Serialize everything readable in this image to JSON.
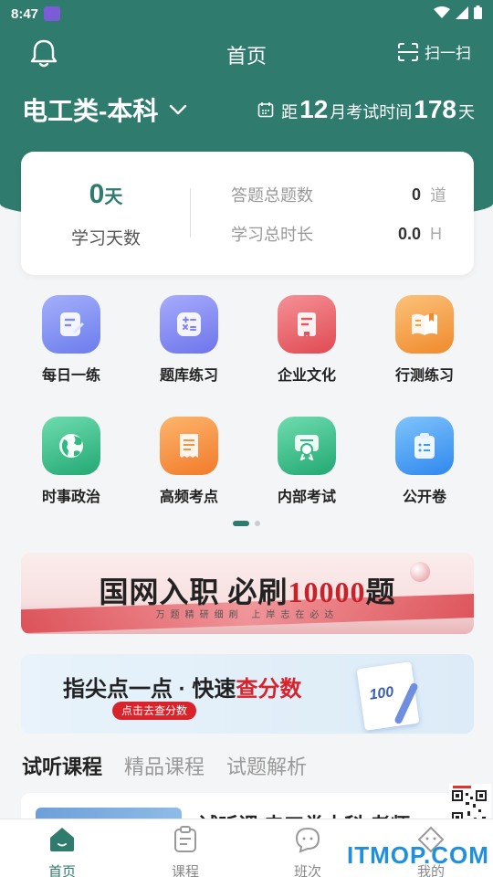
{
  "status_bar": {
    "time": "8:47"
  },
  "top_bar": {
    "title": "首页",
    "scan_label": "扫一扫"
  },
  "subject": {
    "name": "电工类-本科"
  },
  "countdown": {
    "prefix": "距",
    "month": "12",
    "middle": "月考试时间",
    "days": "178",
    "suffix": "天"
  },
  "stats": {
    "study_days_value": "0",
    "study_days_unit": "天",
    "study_days_label": "学习天数",
    "total_questions_label": "答题总题数",
    "total_questions_value": "0",
    "total_questions_unit": "道",
    "total_time_label": "学习总时长",
    "total_time_value": "0.0",
    "total_time_unit": "H"
  },
  "grid": [
    {
      "label": "每日一练",
      "icon": "daily-practice-icon",
      "color": "#7c8cf0"
    },
    {
      "label": "题库练习",
      "icon": "calculator-icon",
      "color": "#7d84f2"
    },
    {
      "label": "企业文化",
      "icon": "book-icon",
      "color": "#e9545b"
    },
    {
      "label": "行测练习",
      "icon": "open-book-icon",
      "color": "#f6a043"
    },
    {
      "label": "时事政治",
      "icon": "globe-icon",
      "color": "#2fba84"
    },
    {
      "label": "高频考点",
      "icon": "receipt-icon",
      "color": "#f7913e"
    },
    {
      "label": "内部考试",
      "icon": "certificate-icon",
      "color": "#2fba84"
    },
    {
      "label": "公开卷",
      "icon": "clipboard-list-icon",
      "color": "#3d9bf2"
    }
  ],
  "banner1": {
    "title_a": "国网入职 必刷",
    "title_num": "10000",
    "title_b": "题",
    "subtitle": "万题精研细刷 上岸志在必达"
  },
  "banner2": {
    "title_a": "指尖点一点 · 快速",
    "title_hl": "查分数",
    "button": "点击去查分数",
    "paper_score": "100"
  },
  "tabs": [
    {
      "label": "试听课程"
    },
    {
      "label": "精品课程"
    },
    {
      "label": "试题解析"
    }
  ],
  "course": {
    "title": "试听课 电工类本科 老师"
  },
  "bottom_nav": [
    {
      "label": "首页"
    },
    {
      "label": "课程"
    },
    {
      "label": "班次"
    },
    {
      "label": "我的"
    }
  ],
  "watermark": "ITMOP.COM"
}
